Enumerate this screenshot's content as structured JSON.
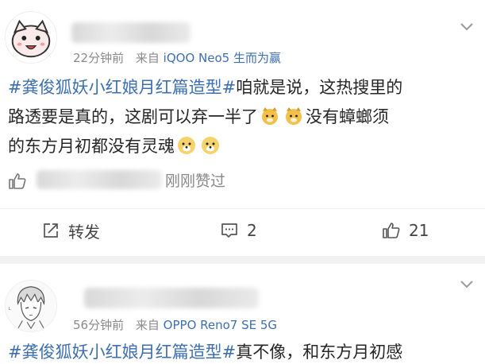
{
  "post1": {
    "meta": {
      "time": "22分钟前",
      "from": "来自",
      "source": "iQOO Neo5 生而为赢"
    },
    "content": {
      "hashtag": "#龚俊狐妖小红娘月红篇造型#",
      "line1_rest": "咱就是说，这热搜里的",
      "line2a": "路透要是真的，这剧可以弃一半了",
      "line2b": "没有蟑螂须",
      "line3": "的东方月初都没有灵魂"
    },
    "likes_text": "刚刚赞过",
    "actions": {
      "repost": "转发",
      "comment": "2",
      "like": "21"
    }
  },
  "post2": {
    "meta": {
      "time": "56分钟前",
      "from": "来自",
      "source": "OPPO Reno7 SE 5G"
    },
    "content": {
      "hashtag": "#龚俊狐妖小红娘月红篇造型#",
      "rest": "真不像，和东方月初感"
    }
  },
  "icons": [
    "chevron-down-icon",
    "thumbs-up-icon",
    "repost-icon",
    "comment-icon",
    "dog-emoji-icon"
  ]
}
